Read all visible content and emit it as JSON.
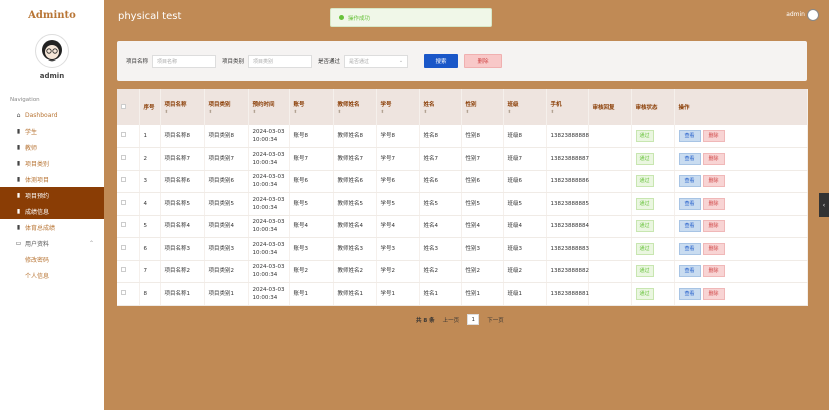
{
  "brand": "Adminto",
  "sidebar": {
    "user_name": "admin",
    "nav_title": "Navigation",
    "items": [
      {
        "label": "Dashboard",
        "icon": "⌂"
      },
      {
        "label": "学生",
        "icon": "▮"
      },
      {
        "label": "教师",
        "icon": "▮"
      },
      {
        "label": "项目类别",
        "icon": "▮"
      },
      {
        "label": "体测项目",
        "icon": "▮"
      },
      {
        "label": "项目预约",
        "icon": "▮"
      },
      {
        "label": "成绩信息",
        "icon": "▮"
      },
      {
        "label": "体育总成绩",
        "icon": "▮"
      },
      {
        "label": "用户资料",
        "icon": "▭",
        "caret": "⌃"
      },
      {
        "label": "修改密码"
      },
      {
        "label": "个人信息"
      }
    ]
  },
  "header": {
    "title": "physical test",
    "toast": "操作成功",
    "user": "admin"
  },
  "search": {
    "label1": "项目名称",
    "placeholder1": "项目名称",
    "label2": "项目类别",
    "placeholder2": "项目类别",
    "label3": "是否通过",
    "placeholder3": "是否通过",
    "select_caret": "⌄",
    "search_btn": "搜索",
    "delete_btn": "删除"
  },
  "table": {
    "headers": [
      "序号",
      "项目名称",
      "项目类别",
      "预约时间",
      "账号",
      "教师姓名",
      "学号",
      "姓名",
      "性别",
      "班级",
      "手机",
      "审核回复",
      "审核状态",
      "操作"
    ],
    "sort_glyph": "⬍",
    "rows": [
      [
        "1",
        "项目名称8",
        "项目类别8",
        "2024-03-03 10:00:34",
        "账号8",
        "教师姓名8",
        "学号8",
        "姓名8",
        "性别8",
        "班级8",
        "13823888888",
        "",
        "通过"
      ],
      [
        "2",
        "项目名称7",
        "项目类别7",
        "2024-03-03 10:00:34",
        "账号7",
        "教师姓名7",
        "学号7",
        "姓名7",
        "性别7",
        "班级7",
        "13823888887",
        "",
        "通过"
      ],
      [
        "3",
        "项目名称6",
        "项目类别6",
        "2024-03-03 10:00:34",
        "账号6",
        "教师姓名6",
        "学号6",
        "姓名6",
        "性别6",
        "班级6",
        "13823888886",
        "",
        "通过"
      ],
      [
        "4",
        "项目名称5",
        "项目类别5",
        "2024-03-03 10:00:34",
        "账号5",
        "教师姓名5",
        "学号5",
        "姓名5",
        "性别5",
        "班级5",
        "13823888885",
        "",
        "通过"
      ],
      [
        "5",
        "项目名称4",
        "项目类别4",
        "2024-03-03 10:00:34",
        "账号4",
        "教师姓名4",
        "学号4",
        "姓名4",
        "性别4",
        "班级4",
        "13823888884",
        "",
        "通过"
      ],
      [
        "6",
        "项目名称3",
        "项目类别3",
        "2024-03-03 10:00:34",
        "账号3",
        "教师姓名3",
        "学号3",
        "姓名3",
        "性别3",
        "班级3",
        "13823888883",
        "",
        "通过"
      ],
      [
        "7",
        "项目名称2",
        "项目类别2",
        "2024-03-03 10:00:34",
        "账号2",
        "教师姓名2",
        "学号2",
        "姓名2",
        "性别2",
        "班级2",
        "13823888882",
        "",
        "通过"
      ],
      [
        "8",
        "项目名称1",
        "项目类别1",
        "2024-03-03 10:00:34",
        "账号1",
        "教师姓名1",
        "学号1",
        "姓名1",
        "性别1",
        "班级1",
        "13823888881",
        "",
        "通过"
      ]
    ],
    "view_btn": "查看",
    "delete_btn": "删除"
  },
  "pagination": {
    "total": "共 8 条",
    "prev": "上一页",
    "current": "1",
    "next": "下一页"
  },
  "side_toggle": "‹",
  "colors": {
    "accent": "#8a3d05",
    "background": "#c08a55",
    "primary": "#1a57c8",
    "success": "#67c23a",
    "danger": "#d04848"
  }
}
